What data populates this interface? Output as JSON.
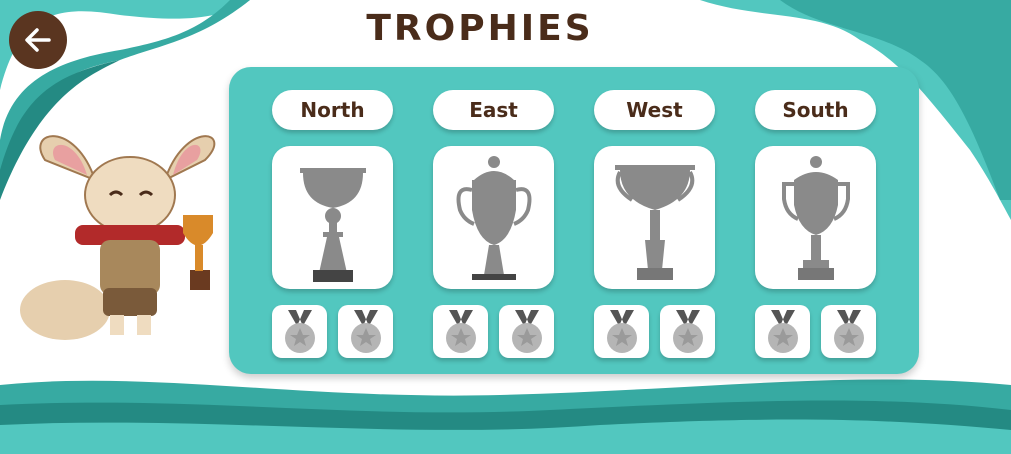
{
  "header": {
    "title": "TROPHIES",
    "back_icon": "arrow-left-icon"
  },
  "colors": {
    "teal": "#52c7bf",
    "brown": "#5a3520",
    "locked": "#8a8a8a"
  },
  "regions": [
    {
      "label": "North",
      "trophy": "cup-trophy",
      "trophy_locked": true,
      "medals_locked": [
        true,
        true
      ]
    },
    {
      "label": "East",
      "trophy": "lidded-cup-trophy",
      "trophy_locked": true,
      "medals_locked": [
        true,
        true
      ]
    },
    {
      "label": "West",
      "trophy": "handled-cup-trophy",
      "trophy_locked": true,
      "medals_locked": [
        true,
        true
      ]
    },
    {
      "label": "South",
      "trophy": "lidded-handled-trophy",
      "trophy_locked": true,
      "medals_locked": [
        true,
        true
      ]
    }
  ]
}
